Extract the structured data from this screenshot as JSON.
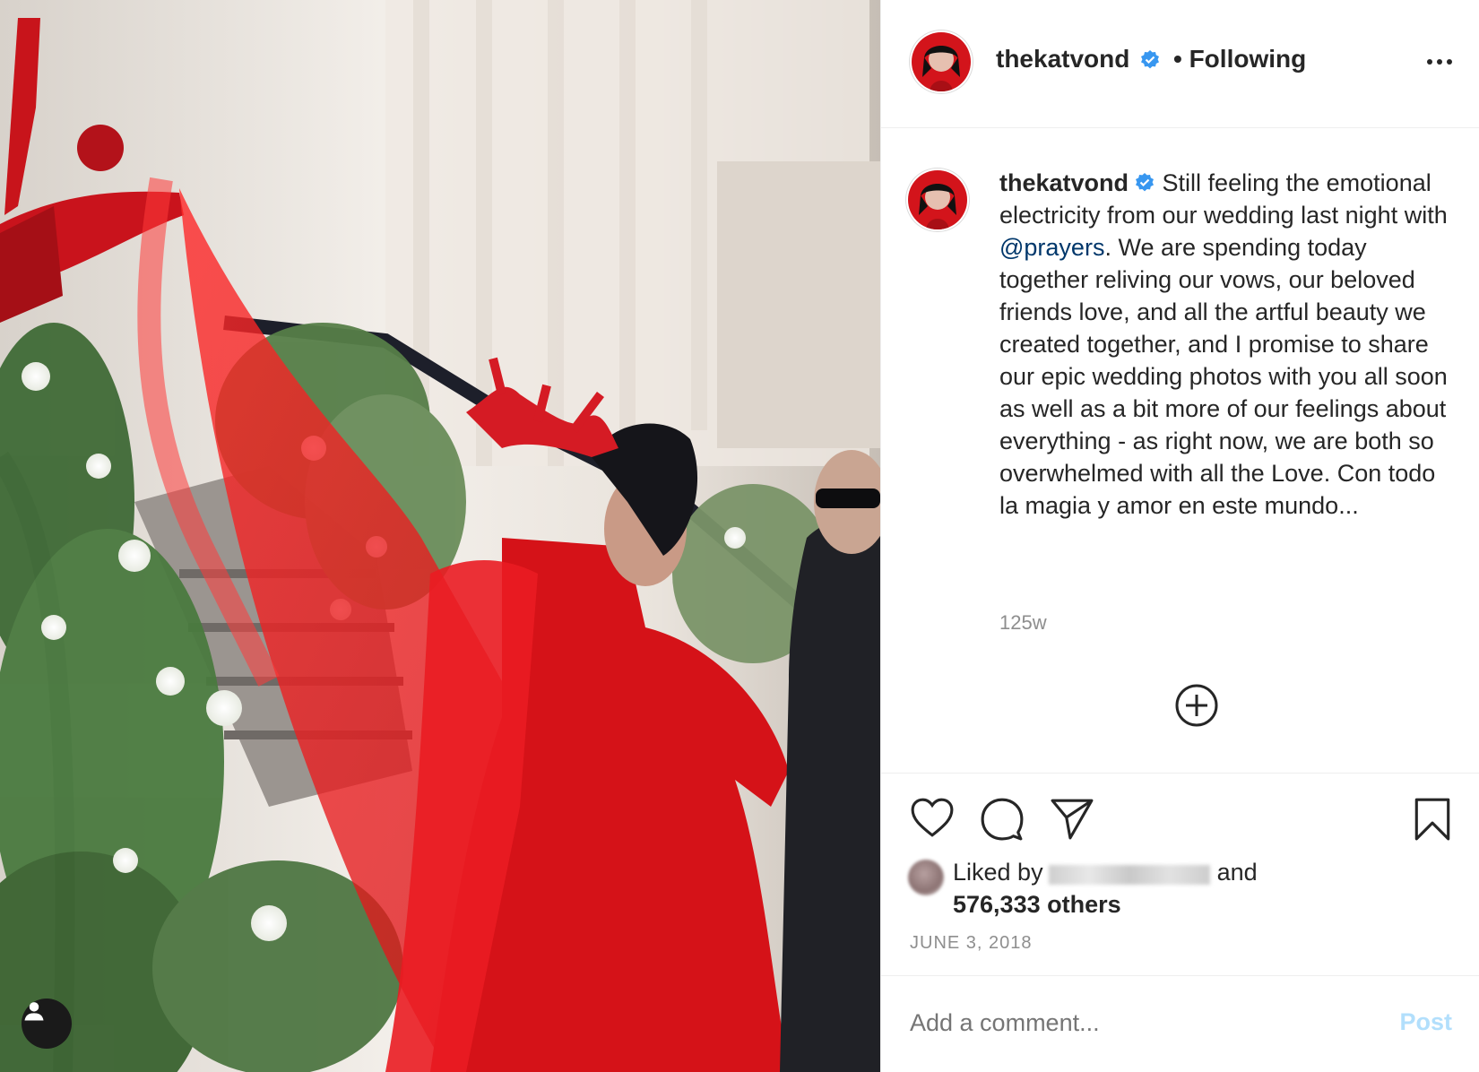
{
  "post": {
    "username": "thekatvond",
    "following_label": "• Following",
    "caption_user": "thekatvond",
    "caption_part1": "Still feeling the emotional electricity from our wedding last night with ",
    "caption_mention": "@prayers",
    "caption_part2": ". We are spending today together reliving our vows, our beloved friends love, and all the artful beauty we created together, and I promise to share our epic wedding photos with you all soon as well as a bit more of our feelings about everything - as right now, we are both so overwhelmed with all the Love. Con todo la magia y amor en este mundo...",
    "age": "125w",
    "liked_prefix": "Liked by",
    "liked_and": "and",
    "liked_count": "576,333 others",
    "date": "JUNE 3, 2018",
    "comment_placeholder": "Add a comment...",
    "post_label": "Post"
  },
  "colors": {
    "accent_blue": "#0095f6",
    "verified": "#3897f0",
    "post_disabled": "#b2dffc",
    "secondary_text": "#8e8e8e",
    "mention": "#00376b"
  },
  "icons": {
    "more": "more-options-icon",
    "verified": "verified-badge-icon",
    "add": "add-circle-icon",
    "like": "heart-icon",
    "comment": "comment-icon",
    "share": "share-icon",
    "save": "bookmark-icon",
    "tag": "user-tag-icon"
  }
}
